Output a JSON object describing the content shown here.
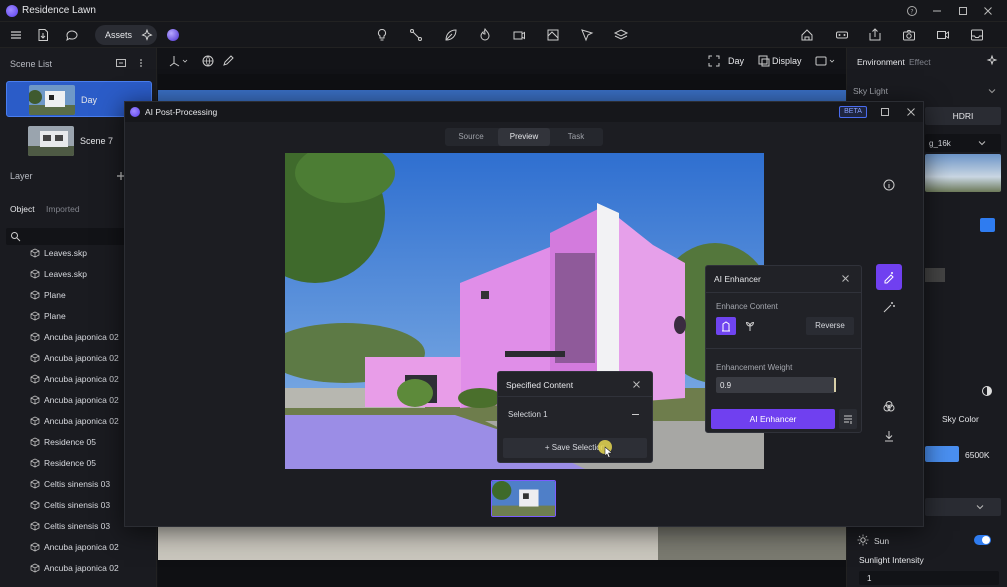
{
  "app": {
    "title": "Residence Lawn"
  },
  "toolbar": {
    "assets_label": "Assets"
  },
  "left_panel": {
    "scene_list_title": "Scene List",
    "scenes": [
      {
        "label": "Day"
      },
      {
        "label": "Scene 7"
      }
    ],
    "layer_title": "Layer",
    "tabs": [
      "Object",
      "Imported"
    ],
    "layers": [
      "Leaves.skp",
      "Leaves.skp",
      "Plane",
      "Plane",
      "Ancuba japonica 02",
      "Ancuba japonica 02",
      "Ancuba japonica 02",
      "Ancuba japonica 02",
      "Ancuba japonica 02",
      "Residence 05",
      "Residence 05",
      "Celtis sinensis 03",
      "Celtis sinensis 03",
      "Celtis sinensis 03",
      "Ancuba japonica 02",
      "Ancuba japonica 02"
    ]
  },
  "viewport": {
    "day_label": "Day",
    "display_label": "Display"
  },
  "right_panel": {
    "tab_environment": "Environment",
    "tab_effect": "Effect",
    "sky_light": "Sky Light",
    "hdri": "HDRI",
    "hdri_file": "g_16k",
    "sky_color": "Sky Color",
    "kelvin": "6500K",
    "sun_label": "Sun",
    "sunlight_intensity": "Sunlight Intensity",
    "sunlight_value": "1"
  },
  "dialog": {
    "title": "AI Post-Processing",
    "beta": "BETA",
    "tabs": [
      "Source",
      "Preview",
      "Task"
    ],
    "active_tab": "Preview"
  },
  "enhancer": {
    "title": "AI Enhancer",
    "content_label": "Enhance Content",
    "reverse": "Reverse",
    "weight_label": "Enhancement Weight",
    "weight_value": "0.9",
    "button": "AI Enhancer"
  },
  "specified": {
    "title": "Specified Content",
    "selection": "Selection 1",
    "save": "+ Save Selection"
  },
  "colors": {
    "accent": "#7040f0",
    "highlight": "#e08ee8",
    "sky": "#3c7fd8"
  }
}
